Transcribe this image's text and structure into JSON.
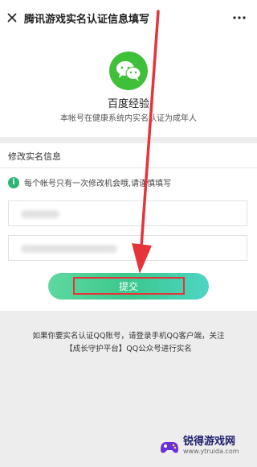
{
  "header": {
    "title": "腾讯游戏实名认证信息填写",
    "close_icon": "close-icon",
    "more_icon": "more-icon"
  },
  "account": {
    "logo_icon": "wechat-logo-icon",
    "name": "百度经验",
    "description": "本帐号在健康系统内实名认证为成年人"
  },
  "form": {
    "section_title": "修改实名信息",
    "notice": "每个帐号只有一次修改机会哦,请谨慎填写",
    "name_field": {
      "value": "",
      "placeholder": ""
    },
    "id_field": {
      "value": "",
      "placeholder": ""
    },
    "submit_label": "提交"
  },
  "footer": {
    "line1": "如果你要实名认证QQ账号，请登录手机QQ客户端，关注",
    "line2": "【成长守护平台】QQ公众号进行实名"
  },
  "watermark": {
    "title": "锐得游戏网",
    "url": "www.ytruida.com"
  },
  "colors": {
    "accent_green": "#3bc88d",
    "highlight_red": "#e5343a"
  }
}
